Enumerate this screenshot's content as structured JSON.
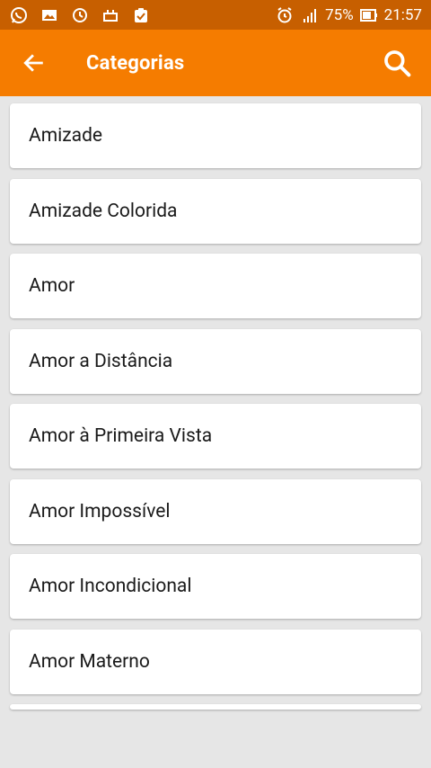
{
  "status_bar": {
    "battery": "75%",
    "time": "21:57",
    "left_icons": [
      "whatsapp-icon",
      "gallery-icon",
      "sync-icon",
      "app-icon",
      "clipboard-check-icon"
    ],
    "right_icons": [
      "alarm-icon",
      "signal-icon",
      "battery-icon"
    ]
  },
  "appbar": {
    "title": "Categorias",
    "back_icon": "arrow-left-icon",
    "search_icon": "search-icon"
  },
  "categories": [
    "Amizade",
    "Amizade Colorida",
    "Amor",
    "Amor a Distância",
    "Amor à Primeira Vista",
    "Amor Impossível",
    "Amor Incondicional",
    "Amor Materno"
  ],
  "colors": {
    "status_bar": "#c75f00",
    "app_bar": "#f57c00",
    "background": "#e6e6e6",
    "card": "#ffffff"
  }
}
